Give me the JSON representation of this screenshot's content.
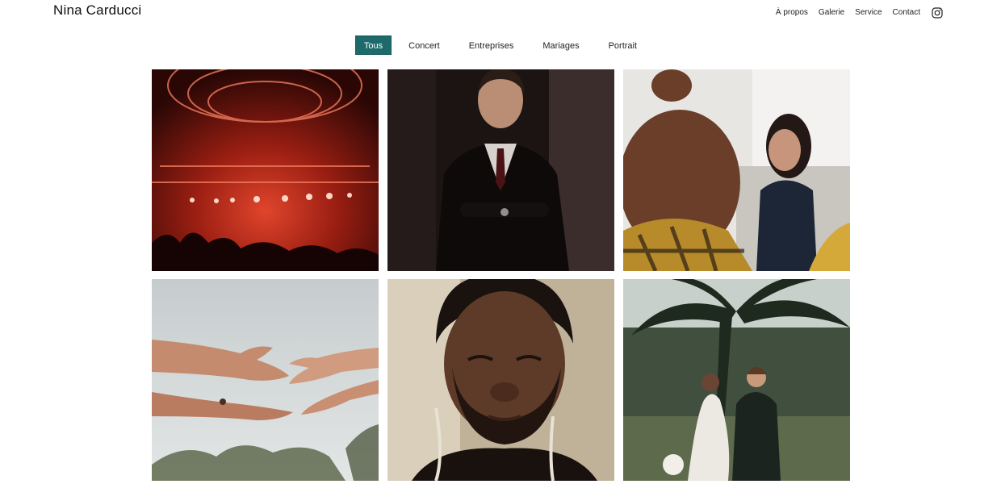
{
  "header": {
    "site_title": "Nina Carducci",
    "nav": [
      {
        "label": "À propos"
      },
      {
        "label": "Galerie"
      },
      {
        "label": "Service"
      },
      {
        "label": "Contact"
      }
    ],
    "social_icon": "instagram-icon"
  },
  "filters": {
    "items": [
      {
        "label": "Tous",
        "active": true
      },
      {
        "label": "Concert",
        "active": false
      },
      {
        "label": "Entreprises",
        "active": false
      },
      {
        "label": "Mariages",
        "active": false
      },
      {
        "label": "Portrait",
        "active": false
      }
    ],
    "active_color": "#1d6a6a"
  },
  "gallery": {
    "photos": [
      {
        "subject": "concert-stage-red-lights"
      },
      {
        "subject": "businessman-suit-portrait"
      },
      {
        "subject": "office-meeting-smiling-woman"
      },
      {
        "subject": "reaching-hands-couple"
      },
      {
        "subject": "man-portrait-eyes-closed"
      },
      {
        "subject": "wedding-couple-walking"
      }
    ]
  }
}
